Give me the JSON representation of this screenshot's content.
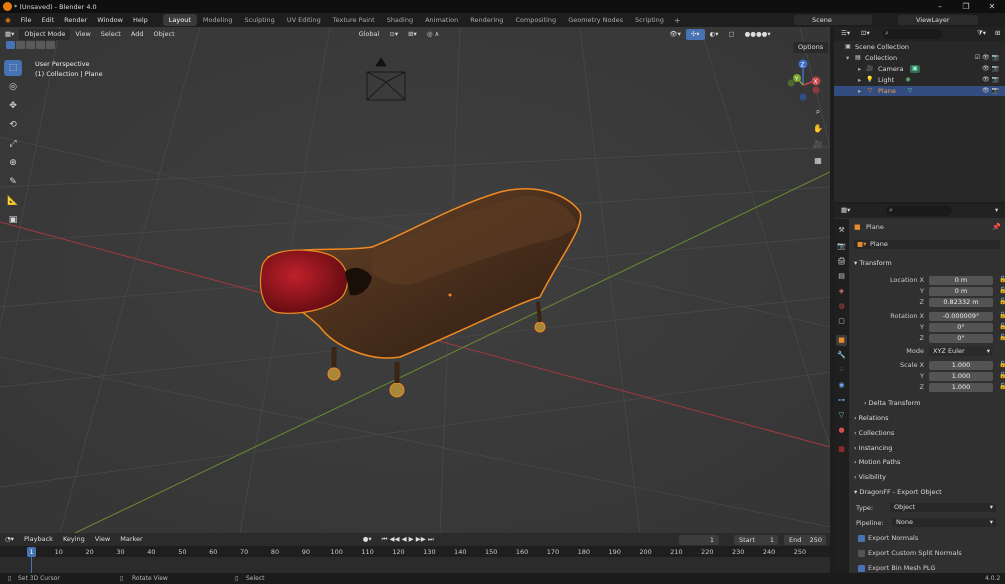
{
  "window": {
    "title": "* (Unsaved) - Blender 4.0"
  },
  "menu": {
    "items": [
      "File",
      "Edit",
      "Render",
      "Window",
      "Help"
    ]
  },
  "workspaces": [
    "Layout",
    "Modeling",
    "Sculpting",
    "UV Editing",
    "Texture Paint",
    "Shading",
    "Animation",
    "Rendering",
    "Compositing",
    "Geometry Nodes",
    "Scripting"
  ],
  "active_workspace": "Layout",
  "scene": {
    "name": "Scene",
    "view_layer": "ViewLayer"
  },
  "viewport": {
    "mode": "Object Mode",
    "menus": [
      "View",
      "Select",
      "Add",
      "Object"
    ],
    "orientation": "Global",
    "options_label": "Options",
    "info_line1": "User Perspective",
    "info_line2": "(1) Collection | Plane",
    "gizmo": {
      "x": "X",
      "y": "Y",
      "z": "Z"
    }
  },
  "timeline": {
    "menus": [
      "Playback",
      "Keying",
      "View",
      "Marker"
    ],
    "current_frame": "1",
    "start_label": "Start",
    "start": "1",
    "end_label": "End",
    "end": "250",
    "ticks": [
      "1",
      "10",
      "20",
      "30",
      "40",
      "50",
      "60",
      "70",
      "80",
      "90",
      "100",
      "110",
      "120",
      "130",
      "140",
      "150",
      "160",
      "170",
      "180",
      "190",
      "200",
      "210",
      "220",
      "230",
      "240",
      "250"
    ]
  },
  "statusbar": {
    "left": "Set 3D Cursor",
    "mid": "Rotate View",
    "right": "Select",
    "version": "4.0.2"
  },
  "outliner": {
    "root": "Scene Collection",
    "collection": "Collection",
    "items": [
      {
        "name": "Camera",
        "color": "#8aaee0"
      },
      {
        "name": "Light",
        "color": "#8aaee0"
      },
      {
        "name": "Plane",
        "color": "#f0a040"
      }
    ]
  },
  "properties": {
    "object_name": "Plane",
    "data_name": "Plane",
    "transform_label": "Transform",
    "location_label": "Location X",
    "location": [
      "0 m",
      "0 m",
      "0.82332 m"
    ],
    "rotation_label": "Rotation X",
    "rotation": [
      "-0.000009°",
      "0°",
      "0°"
    ],
    "mode_label": "Mode",
    "mode": "XYZ Euler",
    "scale_label": "Scale X",
    "scale": [
      "1.000",
      "1.000",
      "1.000"
    ],
    "axis_y": "Y",
    "axis_z": "Z",
    "panels": [
      "Delta Transform",
      "Relations",
      "Collections",
      "Instancing",
      "Motion Paths",
      "Visibility"
    ],
    "dragonff": {
      "title": "DragonFF - Export Object",
      "type_label": "Type:",
      "type": "Object",
      "pipeline_label": "Pipeline:",
      "pipeline": "None",
      "export_normals": "Export Normals",
      "export_split": "Export Custom Split Normals",
      "export_binmesh": "Export Bin Mesh PLG"
    }
  },
  "colors": {
    "accent": "#4772b3",
    "selection": "#e8892a",
    "x_axis": "#c0464e",
    "y_axis": "#7ea630"
  }
}
